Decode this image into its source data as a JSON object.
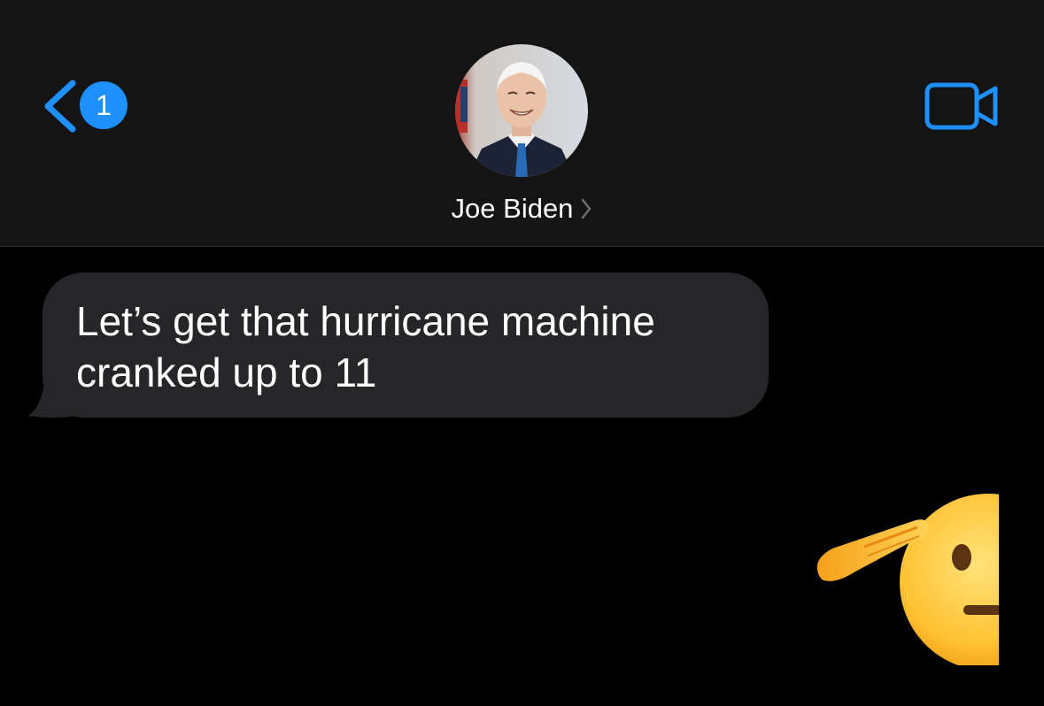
{
  "header": {
    "unread_count": "1",
    "contact_name": "Joe Biden"
  },
  "messages": [
    {
      "direction": "incoming",
      "text": "Let’s get that hurricane machine cranked up to 11"
    },
    {
      "direction": "outgoing",
      "emoji": "saluting-face"
    }
  ],
  "colors": {
    "accent": "#1e90ff",
    "header_bg": "#141414",
    "bubble_bg": "#262628",
    "background": "#000000"
  },
  "icons": {
    "back": "chevron-left-icon",
    "video": "video-camera-icon",
    "name_chevron": "chevron-right-icon"
  }
}
